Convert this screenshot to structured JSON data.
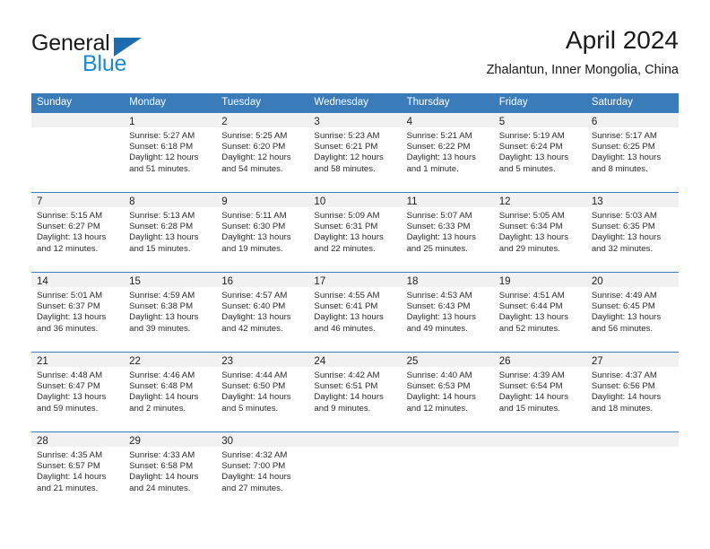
{
  "logo": {
    "line1": "General",
    "line2": "Blue",
    "triangle_color": "#1d6cb0",
    "blue_text_color": "#1f8ad2"
  },
  "header": {
    "title": "April 2024",
    "subtitle": "Zhalantun, Inner Mongolia, China"
  },
  "calendar": {
    "header_bg": "#3a7cba",
    "day_band_bg": "#f1f1f1",
    "weekdays": [
      "Sunday",
      "Monday",
      "Tuesday",
      "Wednesday",
      "Thursday",
      "Friday",
      "Saturday"
    ],
    "weeks": [
      [
        {
          "day": "",
          "sunrise": "",
          "sunset": "",
          "daylight1": "",
          "daylight2": ""
        },
        {
          "day": "1",
          "sunrise": "Sunrise: 5:27 AM",
          "sunset": "Sunset: 6:18 PM",
          "daylight1": "Daylight: 12 hours",
          "daylight2": "and 51 minutes."
        },
        {
          "day": "2",
          "sunrise": "Sunrise: 5:25 AM",
          "sunset": "Sunset: 6:20 PM",
          "daylight1": "Daylight: 12 hours",
          "daylight2": "and 54 minutes."
        },
        {
          "day": "3",
          "sunrise": "Sunrise: 5:23 AM",
          "sunset": "Sunset: 6:21 PM",
          "daylight1": "Daylight: 12 hours",
          "daylight2": "and 58 minutes."
        },
        {
          "day": "4",
          "sunrise": "Sunrise: 5:21 AM",
          "sunset": "Sunset: 6:22 PM",
          "daylight1": "Daylight: 13 hours",
          "daylight2": "and 1 minute."
        },
        {
          "day": "5",
          "sunrise": "Sunrise: 5:19 AM",
          "sunset": "Sunset: 6:24 PM",
          "daylight1": "Daylight: 13 hours",
          "daylight2": "and 5 minutes."
        },
        {
          "day": "6",
          "sunrise": "Sunrise: 5:17 AM",
          "sunset": "Sunset: 6:25 PM",
          "daylight1": "Daylight: 13 hours",
          "daylight2": "and 8 minutes."
        }
      ],
      [
        {
          "day": "7",
          "sunrise": "Sunrise: 5:15 AM",
          "sunset": "Sunset: 6:27 PM",
          "daylight1": "Daylight: 13 hours",
          "daylight2": "and 12 minutes."
        },
        {
          "day": "8",
          "sunrise": "Sunrise: 5:13 AM",
          "sunset": "Sunset: 6:28 PM",
          "daylight1": "Daylight: 13 hours",
          "daylight2": "and 15 minutes."
        },
        {
          "day": "9",
          "sunrise": "Sunrise: 5:11 AM",
          "sunset": "Sunset: 6:30 PM",
          "daylight1": "Daylight: 13 hours",
          "daylight2": "and 19 minutes."
        },
        {
          "day": "10",
          "sunrise": "Sunrise: 5:09 AM",
          "sunset": "Sunset: 6:31 PM",
          "daylight1": "Daylight: 13 hours",
          "daylight2": "and 22 minutes."
        },
        {
          "day": "11",
          "sunrise": "Sunrise: 5:07 AM",
          "sunset": "Sunset: 6:33 PM",
          "daylight1": "Daylight: 13 hours",
          "daylight2": "and 25 minutes."
        },
        {
          "day": "12",
          "sunrise": "Sunrise: 5:05 AM",
          "sunset": "Sunset: 6:34 PM",
          "daylight1": "Daylight: 13 hours",
          "daylight2": "and 29 minutes."
        },
        {
          "day": "13",
          "sunrise": "Sunrise: 5:03 AM",
          "sunset": "Sunset: 6:35 PM",
          "daylight1": "Daylight: 13 hours",
          "daylight2": "and 32 minutes."
        }
      ],
      [
        {
          "day": "14",
          "sunrise": "Sunrise: 5:01 AM",
          "sunset": "Sunset: 6:37 PM",
          "daylight1": "Daylight: 13 hours",
          "daylight2": "and 36 minutes."
        },
        {
          "day": "15",
          "sunrise": "Sunrise: 4:59 AM",
          "sunset": "Sunset: 6:38 PM",
          "daylight1": "Daylight: 13 hours",
          "daylight2": "and 39 minutes."
        },
        {
          "day": "16",
          "sunrise": "Sunrise: 4:57 AM",
          "sunset": "Sunset: 6:40 PM",
          "daylight1": "Daylight: 13 hours",
          "daylight2": "and 42 minutes."
        },
        {
          "day": "17",
          "sunrise": "Sunrise: 4:55 AM",
          "sunset": "Sunset: 6:41 PM",
          "daylight1": "Daylight: 13 hours",
          "daylight2": "and 46 minutes."
        },
        {
          "day": "18",
          "sunrise": "Sunrise: 4:53 AM",
          "sunset": "Sunset: 6:43 PM",
          "daylight1": "Daylight: 13 hours",
          "daylight2": "and 49 minutes."
        },
        {
          "day": "19",
          "sunrise": "Sunrise: 4:51 AM",
          "sunset": "Sunset: 6:44 PM",
          "daylight1": "Daylight: 13 hours",
          "daylight2": "and 52 minutes."
        },
        {
          "day": "20",
          "sunrise": "Sunrise: 4:49 AM",
          "sunset": "Sunset: 6:45 PM",
          "daylight1": "Daylight: 13 hours",
          "daylight2": "and 56 minutes."
        }
      ],
      [
        {
          "day": "21",
          "sunrise": "Sunrise: 4:48 AM",
          "sunset": "Sunset: 6:47 PM",
          "daylight1": "Daylight: 13 hours",
          "daylight2": "and 59 minutes."
        },
        {
          "day": "22",
          "sunrise": "Sunrise: 4:46 AM",
          "sunset": "Sunset: 6:48 PM",
          "daylight1": "Daylight: 14 hours",
          "daylight2": "and 2 minutes."
        },
        {
          "day": "23",
          "sunrise": "Sunrise: 4:44 AM",
          "sunset": "Sunset: 6:50 PM",
          "daylight1": "Daylight: 14 hours",
          "daylight2": "and 5 minutes."
        },
        {
          "day": "24",
          "sunrise": "Sunrise: 4:42 AM",
          "sunset": "Sunset: 6:51 PM",
          "daylight1": "Daylight: 14 hours",
          "daylight2": "and 9 minutes."
        },
        {
          "day": "25",
          "sunrise": "Sunrise: 4:40 AM",
          "sunset": "Sunset: 6:53 PM",
          "daylight1": "Daylight: 14 hours",
          "daylight2": "and 12 minutes."
        },
        {
          "day": "26",
          "sunrise": "Sunrise: 4:39 AM",
          "sunset": "Sunset: 6:54 PM",
          "daylight1": "Daylight: 14 hours",
          "daylight2": "and 15 minutes."
        },
        {
          "day": "27",
          "sunrise": "Sunrise: 4:37 AM",
          "sunset": "Sunset: 6:56 PM",
          "daylight1": "Daylight: 14 hours",
          "daylight2": "and 18 minutes."
        }
      ],
      [
        {
          "day": "28",
          "sunrise": "Sunrise: 4:35 AM",
          "sunset": "Sunset: 6:57 PM",
          "daylight1": "Daylight: 14 hours",
          "daylight2": "and 21 minutes."
        },
        {
          "day": "29",
          "sunrise": "Sunrise: 4:33 AM",
          "sunset": "Sunset: 6:58 PM",
          "daylight1": "Daylight: 14 hours",
          "daylight2": "and 24 minutes."
        },
        {
          "day": "30",
          "sunrise": "Sunrise: 4:32 AM",
          "sunset": "Sunset: 7:00 PM",
          "daylight1": "Daylight: 14 hours",
          "daylight2": "and 27 minutes."
        },
        {
          "day": "",
          "sunrise": "",
          "sunset": "",
          "daylight1": "",
          "daylight2": ""
        },
        {
          "day": "",
          "sunrise": "",
          "sunset": "",
          "daylight1": "",
          "daylight2": ""
        },
        {
          "day": "",
          "sunrise": "",
          "sunset": "",
          "daylight1": "",
          "daylight2": ""
        },
        {
          "day": "",
          "sunrise": "",
          "sunset": "",
          "daylight1": "",
          "daylight2": ""
        }
      ]
    ]
  }
}
